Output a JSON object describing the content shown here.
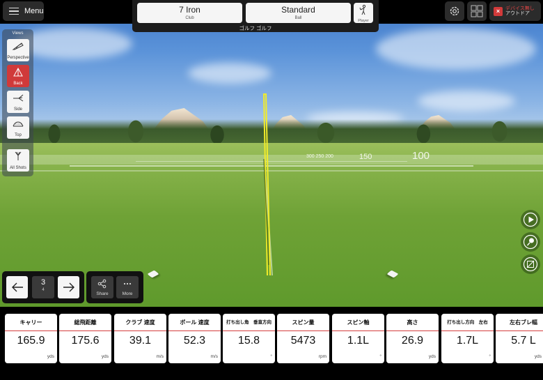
{
  "topbar": {
    "menu_label": "Menu",
    "club": {
      "value": "7 Iron",
      "label": "Club"
    },
    "ball": {
      "value": "Standard",
      "label": "Ball"
    },
    "player_label": "Player",
    "caption": "ゴルフ ゴルフ",
    "device": {
      "line1": "デバイス無し",
      "line2": "アウトドア"
    }
  },
  "views": {
    "title": "Views",
    "items": [
      {
        "label": "Perspective",
        "icon": "perspective-icon",
        "active": false
      },
      {
        "label": "Back",
        "icon": "back-view-icon",
        "active": true
      },
      {
        "label": "Side",
        "icon": "side-view-icon",
        "active": false
      },
      {
        "label": "Top",
        "icon": "top-view-icon",
        "active": false
      },
      {
        "label": "All Shots",
        "icon": "all-shots-icon",
        "active": false
      }
    ]
  },
  "scene": {
    "distance_markers": [
      "150",
      "100"
    ],
    "far_markers": "300 250 200",
    "trajectory_color": "#f2ec2a"
  },
  "shot_nav": {
    "current": "3",
    "total": "4",
    "share_label": "Share",
    "more_label": "More"
  },
  "stats": [
    {
      "label": "キャリー",
      "value": "165.9",
      "unit": "yds"
    },
    {
      "label": "総飛距離",
      "value": "175.6",
      "unit": "yds"
    },
    {
      "label": "クラブ 速度",
      "value": "39.1",
      "unit": "m/s"
    },
    {
      "label": "ボール 速度",
      "value": "52.3",
      "unit": "m/s"
    },
    {
      "label": "打ち出し角　垂直方向",
      "value": "15.8",
      "unit": "°"
    },
    {
      "label": "スピン量",
      "value": "5473",
      "unit": "rpm"
    },
    {
      "label": "スピン軸",
      "value": "1.1L",
      "unit": "°"
    },
    {
      "label": "高さ",
      "value": "26.9",
      "unit": "yds"
    },
    {
      "label": "打ち出し方向　左右",
      "value": "1.7L",
      "unit": "°"
    },
    {
      "label": "左右ブレ幅",
      "value": "5.7 L",
      "unit": "yds"
    }
  ],
  "colors": {
    "accent_red": "#d03a3a",
    "stat_divider": "#d43c3c"
  }
}
